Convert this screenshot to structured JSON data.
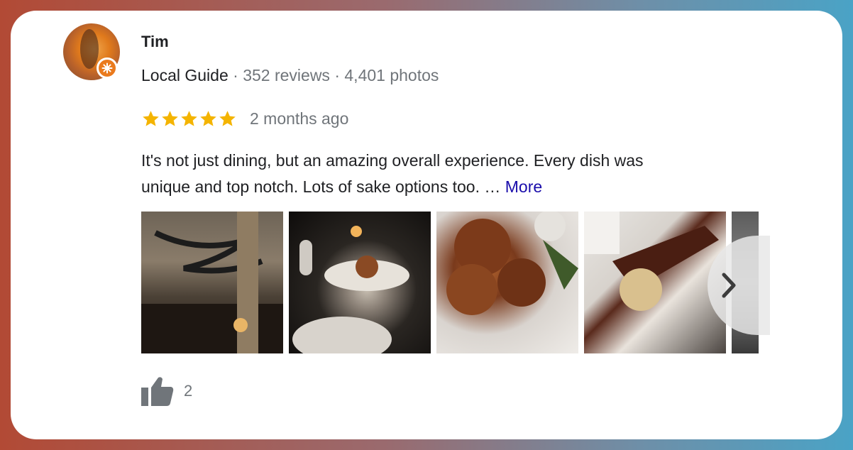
{
  "reviewer": {
    "name": "Tim",
    "badge": "Local Guide",
    "reviews": "352 reviews",
    "photos": "4,401 photos",
    "separator": "·"
  },
  "rating": {
    "stars": 5,
    "max": 5,
    "time_ago": "2 months ago"
  },
  "review": {
    "line1": "It's not just dining, but an amazing overall experience.  Every dish was",
    "line2": "unique and top notch.  Lots of sake options too. … ",
    "more_label": "More"
  },
  "photos": [
    {
      "name": "restaurant-interior-photo"
    },
    {
      "name": "table-dishes-photo"
    },
    {
      "name": "fried-dessert-photo"
    },
    {
      "name": "chocolate-ice-cream-photo"
    },
    {
      "name": "dining-room-photo"
    }
  ],
  "likes": {
    "count": "2",
    "icon": "thumbs-up-icon"
  },
  "colors": {
    "star": "#f4b400",
    "more_link": "#1a0dab",
    "guide_badge": "#ea7a1d",
    "secondary_text": "#70757a"
  }
}
